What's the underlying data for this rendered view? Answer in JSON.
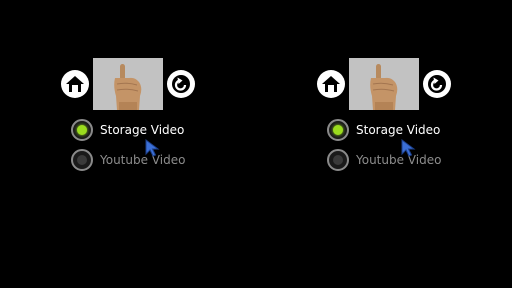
{
  "icons": {
    "home": "home-icon",
    "back": "back-arrow-icon",
    "thumbnail": "hand-gesture-thumbnail",
    "cursor": "pointer-cursor-icon"
  },
  "colors": {
    "background": "#000000",
    "selected_radio": "#9bdc1e",
    "selected_text": "#ffffff",
    "unselected_text": "#8c8c8c"
  },
  "options": [
    {
      "label": "Storage Video",
      "selected": true
    },
    {
      "label": "Youtube Video",
      "selected": false
    }
  ]
}
